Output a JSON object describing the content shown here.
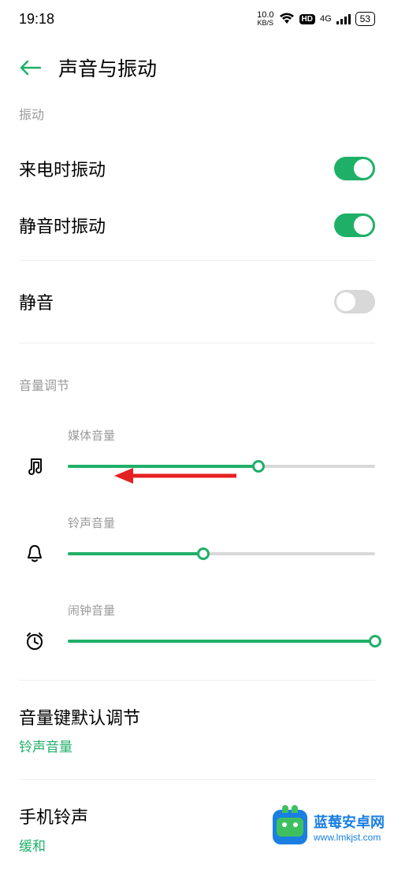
{
  "status": {
    "time": "19:18",
    "speed_value": "10.0",
    "speed_unit": "KB/S",
    "hd_label": "HD",
    "network_label": "4G",
    "battery": "53"
  },
  "header": {
    "title": "声音与振动"
  },
  "sections": {
    "vibration_label": "振动",
    "volume_label": "音量调节"
  },
  "toggles": {
    "ring_vibrate": {
      "label": "来电时振动",
      "on": true
    },
    "silent_vibrate": {
      "label": "静音时振动",
      "on": true
    },
    "silent": {
      "label": "静音",
      "on": false
    }
  },
  "sliders": {
    "media": {
      "label": "媒体音量",
      "percent": 62
    },
    "ring": {
      "label": "铃声音量",
      "percent": 44
    },
    "alarm": {
      "label": "闹钟音量",
      "percent": 100
    }
  },
  "items": {
    "vol_key": {
      "title": "音量键默认调节",
      "sub": "铃声音量"
    },
    "ringtone": {
      "title": "手机铃声",
      "sub": "缓和"
    }
  },
  "watermark": {
    "name": "蓝莓安卓网",
    "url": "www.lmkjst.com"
  },
  "colors": {
    "accent": "#1fb068"
  }
}
